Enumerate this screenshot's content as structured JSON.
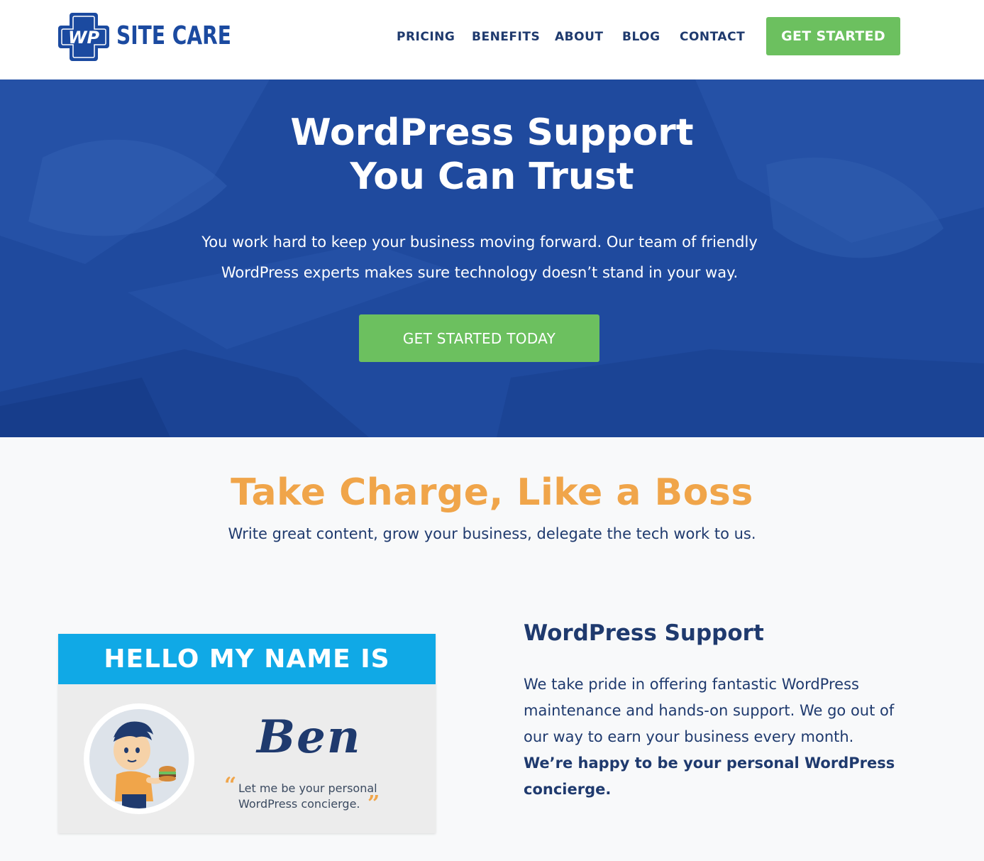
{
  "brand": {
    "logo_mark": "WP",
    "logo_text": "SITE CARE",
    "primary_color": "#1f4a9e",
    "accent_green": "#6cc05f",
    "accent_orange": "#f0a54a",
    "badge_blue": "#10a9e6"
  },
  "nav": {
    "items": [
      {
        "label": "PRICING"
      },
      {
        "label": "BENEFITS"
      },
      {
        "label": "ABOUT"
      },
      {
        "label": "BLOG"
      },
      {
        "label": "CONTACT"
      }
    ],
    "cta_label": "GET STARTED"
  },
  "hero": {
    "title_line1": "WordPress Support",
    "title_line2": "You Can Trust",
    "subtitle": "You work hard to keep your business moving forward. Our team of friendly WordPress experts makes sure technology doesn’t stand in your way.",
    "cta_label": "GET STARTED TODAY"
  },
  "section": {
    "title": "Take Charge, Like a Boss",
    "subtitle": "Write great content, grow your business, delegate the tech work to us."
  },
  "badge": {
    "header": "HELLO MY NAME IS",
    "name": "Ben",
    "quote": "Let me be your personal WordPress concierge.",
    "quote_open": "“",
    "quote_close": "”"
  },
  "support": {
    "title": "WordPress Support",
    "body": "We take pride in offering fantastic WordPress maintenance and hands-on support. We go out of our way to earn your business every month.",
    "body_bold": "We’re happy to be your personal WordPress concierge."
  }
}
